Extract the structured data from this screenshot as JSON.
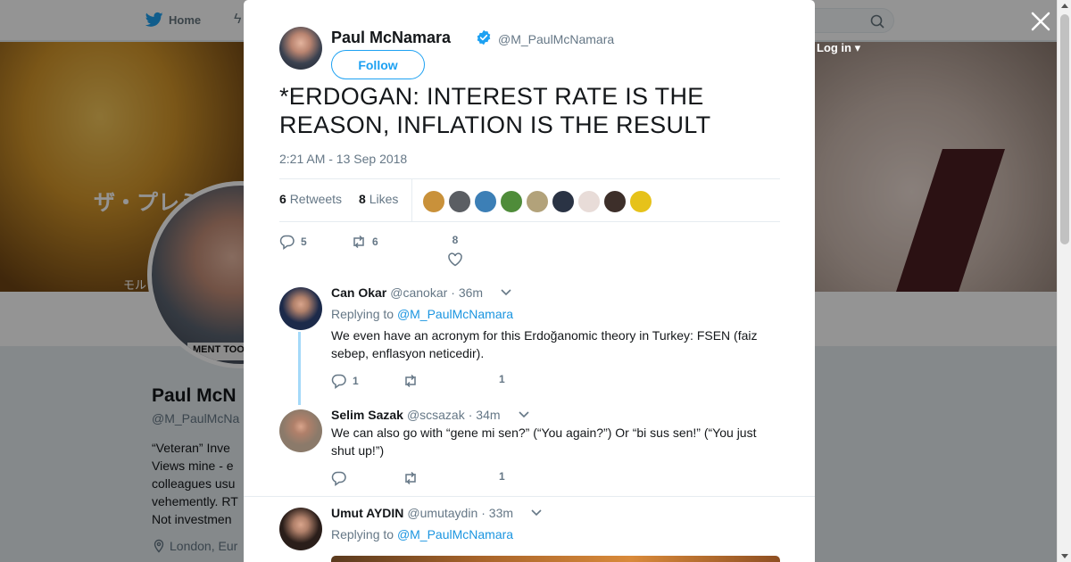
{
  "background": {
    "nav": {
      "home_label": "Home"
    },
    "login_label": "Log in ▾",
    "banner_text_1": "ザ・プレミ",
    "banner_text_2": "モル",
    "profile": {
      "name": "Paul McN",
      "handle": "@M_PaulMcNa",
      "bio_lines": [
        "“Veteran” Inve",
        "Views mine - e",
        "colleagues usu",
        "vehemently. RT",
        "Not investmen"
      ],
      "location": "London, Eur",
      "avatar_sign": "MENT TOO M"
    }
  },
  "tweet": {
    "author_name": "Paul McNamara",
    "author_handle": "@M_PaulMcNamara",
    "follow_label": "Follow",
    "text": "*ERDOGAN: INTEREST RATE IS THE REASON, INFLATION IS THE RESULT",
    "timestamp": "2:21 AM - 13 Sep 2018",
    "retweets_count": "6",
    "retweets_label": "Retweets",
    "likes_count": "8",
    "likes_label": "Likes",
    "action_counts": {
      "replies": "5",
      "retweets": "6",
      "likes": "8"
    }
  },
  "likers": [
    {
      "color": "#c9913a"
    },
    {
      "color": "#5b5e63"
    },
    {
      "color": "#3c7fb6"
    },
    {
      "color": "#4f8c3a"
    },
    {
      "color": "#b2a27a"
    },
    {
      "color": "#2a3344"
    },
    {
      "color": "#e8dcd8"
    },
    {
      "color": "#3d2f2a"
    },
    {
      "color": "#e6c21a"
    }
  ],
  "replies": [
    {
      "name": "Can Okar",
      "handle": "@canokar",
      "time": "· 36m",
      "replying_prefix": "Replying to",
      "replying_to": "@M_PaulMcNamara",
      "text": "We even have an acronym for this Erdoğanomic theory in Turkey: FSEN (faiz sebep, enflasyon neticedir).",
      "reply_count": "1",
      "like_count": "1",
      "avatar_color": "#1c2a4a"
    },
    {
      "name": "Selim Sazak",
      "handle": "@scsazak",
      "time": "· 34m",
      "text": "We can also go with “gene mi sen?” (“You again?”) Or “bi sus sen!” (“You just shut up!”)",
      "like_count": "1",
      "avatar_color": "#8b7a6a"
    },
    {
      "name": "Umut AYDIN",
      "handle": "@umutaydin",
      "time": "· 33m",
      "replying_prefix": "Replying to",
      "replying_to": "@M_PaulMcNamara",
      "avatar_color": "#2a1e1a"
    }
  ],
  "icons": [
    "twitter-bird-icon",
    "lightning-icon",
    "search-icon",
    "location-pin-icon",
    "close-icon",
    "verified-badge-icon",
    "reply-icon",
    "retweet-icon",
    "heart-icon",
    "chevron-down-icon"
  ],
  "colors": {
    "accent": "#1da1f2",
    "link": "#1b95e0",
    "text": "#14171a",
    "muted": "#657786",
    "thread": "#a4d9f9"
  }
}
